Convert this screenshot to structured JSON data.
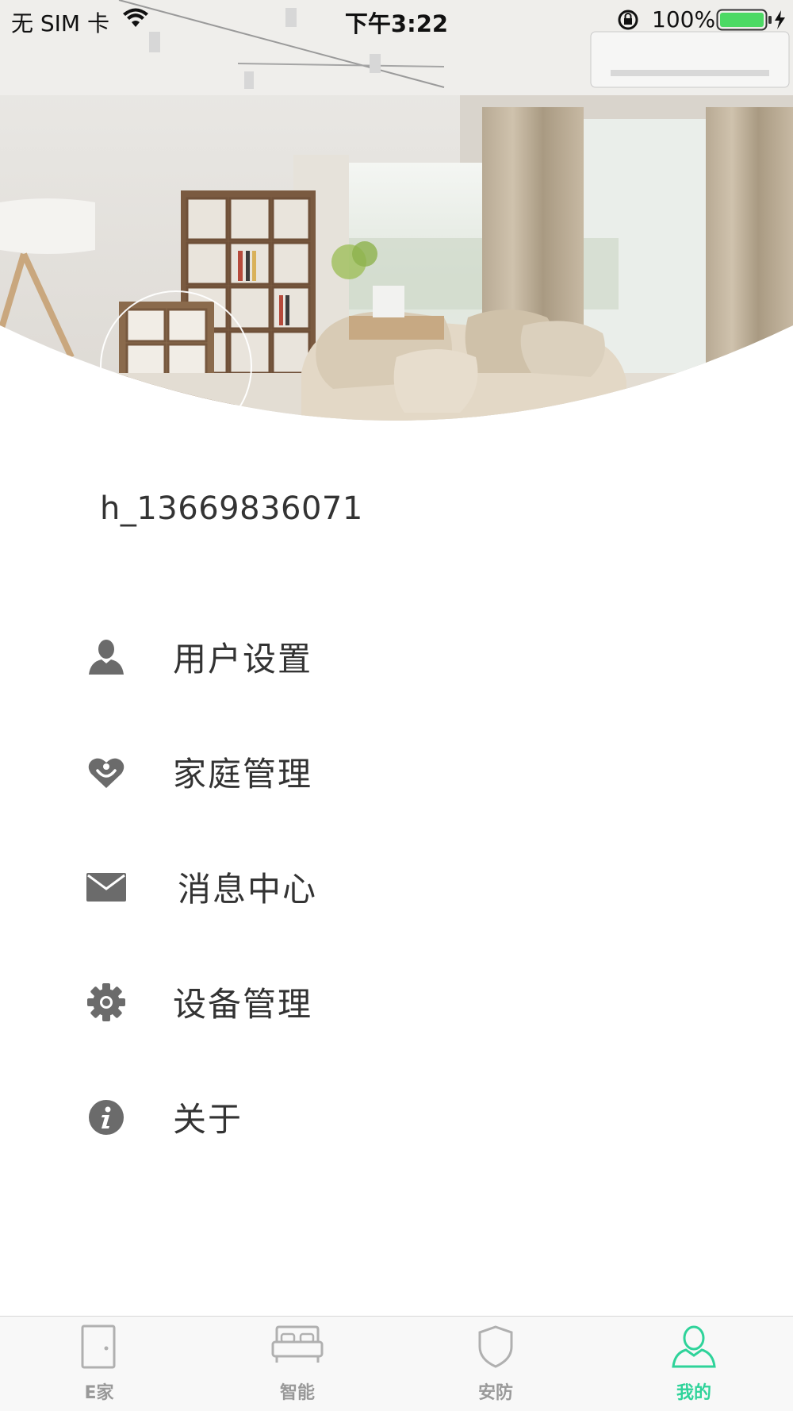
{
  "status_bar": {
    "carrier": "无 SIM 卡",
    "time": "下午3:22",
    "battery": "100%"
  },
  "profile": {
    "username": "h_13669836071"
  },
  "menu": {
    "items": [
      {
        "label": "用户设置",
        "icon": "user-icon"
      },
      {
        "label": "家庭管理",
        "icon": "family-heart-icon"
      },
      {
        "label": "消息中心",
        "icon": "mail-icon"
      },
      {
        "label": "设备管理",
        "icon": "gear-icon"
      },
      {
        "label": "关于",
        "icon": "info-icon"
      }
    ]
  },
  "tab_bar": {
    "tabs": [
      {
        "label": "E家",
        "icon": "door-icon",
        "active": false
      },
      {
        "label": "智能",
        "icon": "bed-icon",
        "active": false
      },
      {
        "label": "安防",
        "icon": "shield-icon",
        "active": false
      },
      {
        "label": "我的",
        "icon": "person-icon",
        "active": true
      }
    ]
  },
  "colors": {
    "accent": "#2fd39a",
    "inactive_tab": "#999999",
    "icon_gray": "#6b6b6b",
    "battery_fill": "#4cd964"
  }
}
